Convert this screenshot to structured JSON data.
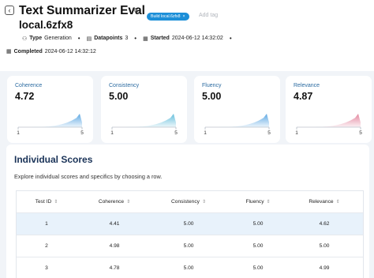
{
  "header": {
    "title": "Text Summarizer Eval",
    "subtitle": "local.6zfx8",
    "tag_label": "Build local.6zfx8",
    "tag_remove": "×",
    "add_tag_placeholder": "Add tag",
    "back_icon": "‹",
    "edit_icon": "✎"
  },
  "meta": {
    "type_label": "Type",
    "type_value": "Generation",
    "datapoints_label": "Datapoints",
    "datapoints_value": "3",
    "started_label": "Started",
    "started_value": "2024-06-12 14:32:02",
    "completed_label": "Completed",
    "completed_value": "2024-06-12 14:32:12",
    "separator": "•"
  },
  "metrics": [
    {
      "label": "Coherence",
      "value": "4.72",
      "axis_min": "1",
      "axis_max": "5",
      "color": "#4d9fe0"
    },
    {
      "label": "Consistency",
      "value": "5.00",
      "axis_min": "1",
      "axis_max": "5",
      "color": "#56b8d8"
    },
    {
      "label": "Fluency",
      "value": "5.00",
      "axis_min": "1",
      "axis_max": "5",
      "color": "#4d9fe0"
    },
    {
      "label": "Relevance",
      "value": "4.87",
      "axis_min": "1",
      "axis_max": "5",
      "color": "#e07a94"
    }
  ],
  "scores": {
    "title": "Individual Scores",
    "description": "Explore individual scores and specifics by choosing a row.",
    "columns": [
      "Test ID",
      "Coherence",
      "Consistency",
      "Fluency",
      "Relevance"
    ],
    "sort_icon": "⇕",
    "rows": [
      [
        "1",
        "4.41",
        "5.00",
        "5.00",
        "4.62"
      ],
      [
        "2",
        "4.98",
        "5.00",
        "5.00",
        "5.00"
      ],
      [
        "3",
        "4.78",
        "5.00",
        "5.00",
        "4.99"
      ]
    ]
  }
}
